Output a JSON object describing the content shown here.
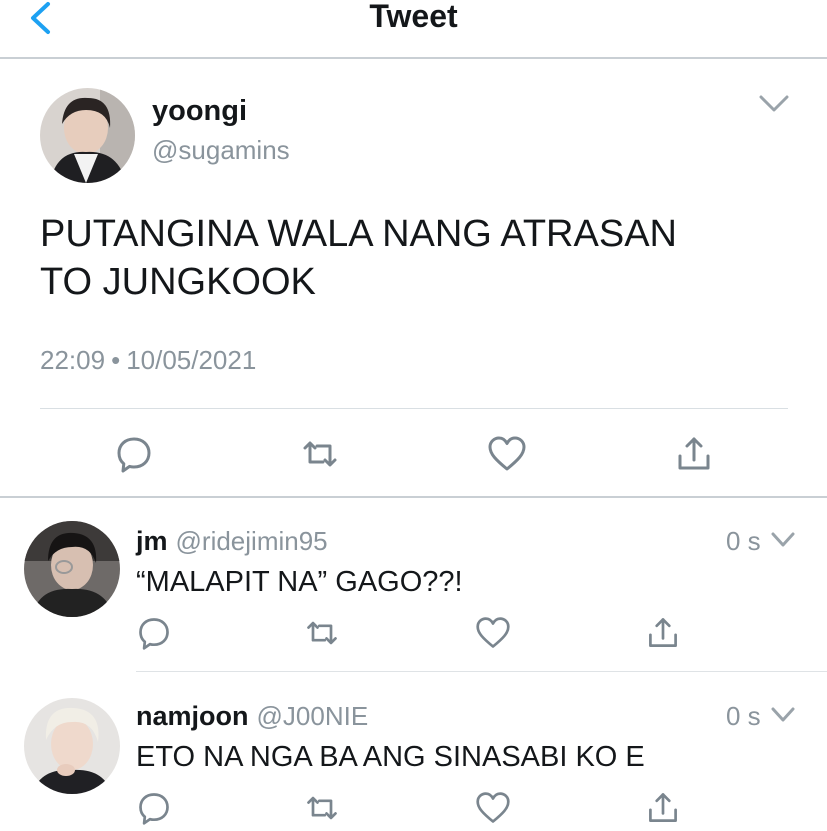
{
  "header": {
    "title": "Tweet",
    "back_icon": "chevron-left-icon",
    "accent": "#1da1f2"
  },
  "tweet": {
    "name": "yoongi",
    "handle": "@sugamins",
    "text_line1": "PUTANGINA WALA NANG ATRASAN",
    "text_line2": "TO JUNGKOOK",
    "time": "22:09",
    "separator": "•",
    "date": "10/05/2021",
    "actions": [
      "reply-icon",
      "retweet-icon",
      "like-icon",
      "share-icon"
    ]
  },
  "replies": [
    {
      "name": "jm",
      "handle": "@ridejimin95",
      "time": "0 s",
      "text": "“MALAPIT NA” GAGO??!"
    },
    {
      "name": "namjoon",
      "handle": "@J00NIE",
      "time": "0 s",
      "text": "ETO NA NGA BA ANG SINASABI KO E"
    }
  ],
  "colors": {
    "text": "#14171a",
    "muted": "#8a949c",
    "icon": "#7a858e",
    "divider": "#c9cfd4"
  }
}
